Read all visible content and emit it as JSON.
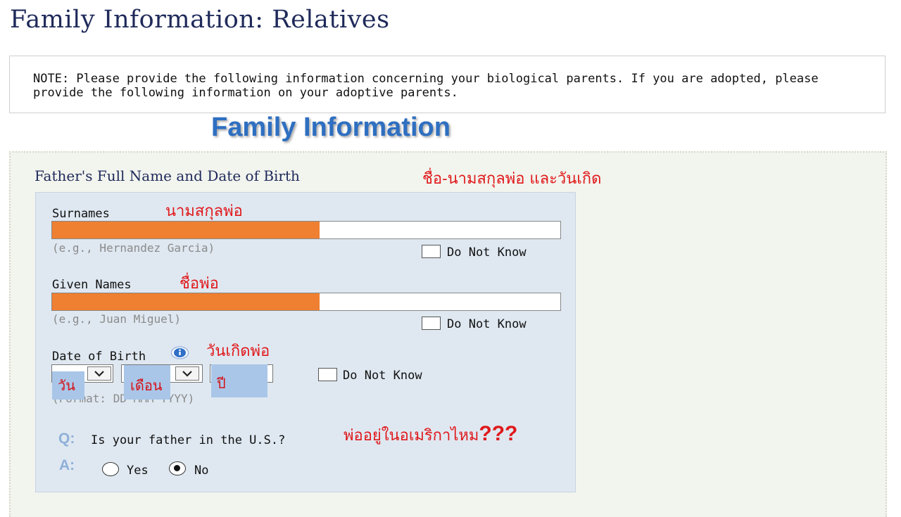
{
  "page": {
    "title": "Family Information: Relatives"
  },
  "note": {
    "text": "NOTE: Please provide the following information concerning your biological parents. If you are adopted, please provide the following information on your adoptive parents."
  },
  "banner": {
    "text": "Family Information"
  },
  "father_section": {
    "heading": "Father's Full Name and Date of Birth",
    "heading_thai": "ชื่อ-นามสกุลพ่อ และวันเกิด",
    "surnames": {
      "label": "Surnames",
      "thai": "นามสกุลพ่อ",
      "hint": "(e.g., Hernandez Garcia)",
      "do_not_know": "Do Not Know",
      "redacted": true
    },
    "given_names": {
      "label": "Given Names",
      "thai": "ชื่อพ่อ",
      "hint": "(e.g., Juan Miguel)",
      "do_not_know": "Do Not Know",
      "redacted": true
    },
    "dob": {
      "label": "Date of Birth",
      "thai": "วันเกิดพ่อ",
      "hint": "(Format: DD-MMM-YYYY)",
      "do_not_know": "Do Not Know",
      "day_overlay": "วัน",
      "month_overlay": "เดือน",
      "year_overlay": "ปี",
      "info_icon": "info-icon"
    },
    "question": {
      "q": "Q:",
      "text": "Is your father in the U.S.?",
      "thai": "พ่ออยู่ในอเมริกาไหม",
      "thai_marks": "???",
      "a": "A:",
      "yes_label": "Yes",
      "no_label": "No",
      "selected": "No"
    }
  },
  "colors": {
    "title": "#1f2a5a",
    "banner": "#2e6fc1",
    "annotation": "#e0191b",
    "redaction": "#ef7f31",
    "form_bg": "#dfe8f1",
    "overlay": "#a9c6e8"
  }
}
